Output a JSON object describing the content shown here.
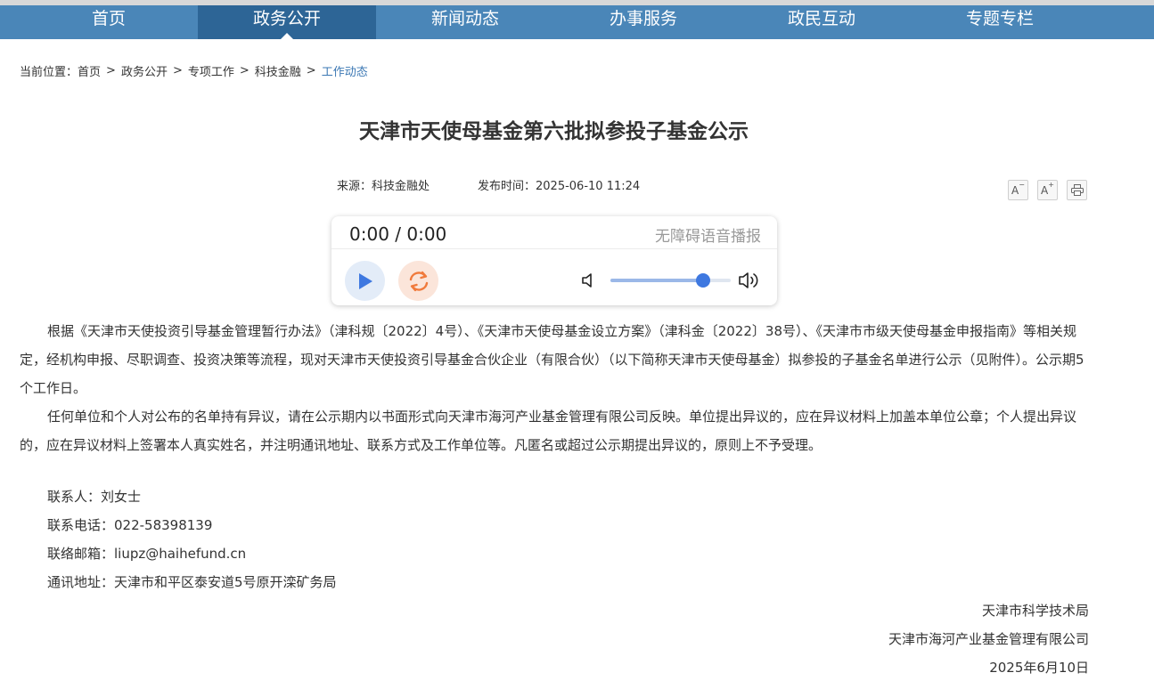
{
  "nav": {
    "items": [
      {
        "label": "首页"
      },
      {
        "label": "政务公开"
      },
      {
        "label": "新闻动态"
      },
      {
        "label": "办事服务"
      },
      {
        "label": "政民互动"
      },
      {
        "label": "专题专栏"
      }
    ],
    "active_index": 1
  },
  "breadcrumb": {
    "prefix": "当前位置：",
    "items": [
      "首页",
      "政务公开",
      "专项工作",
      "科技金融"
    ],
    "current": "工作动态",
    "separator": ">"
  },
  "article": {
    "title": "天津市天使母基金第六批拟参投子基金公示",
    "source": "来源：科技金融处",
    "publish_time": "发布时间：2025-06-10 11:24",
    "paragraphs": [
      "根据《天津市天使投资引导基金管理暂行办法》（津科规〔2022〕4号）、《天津市天使母基金设立方案》（津科金〔2022〕38号）、《天津市市级天使母基金申报指南》等相关规定，经机构申报、尽职调查、投资决策等流程，现对天津市天使投资引导基金合伙企业（有限合伙）（以下简称天津市天使母基金）拟参投的子基金名单进行公示（见附件）。公示期5个工作日。",
      "任何单位和个人对公布的名单持有异议，请在公示期内以书面形式向天津市海河产业基金管理有限公司反映。单位提出异议的，应在异议材料上加盖本单位公章；个人提出异议的，应在异议材料上签署本人真实姓名，并注明通讯地址、联系方式及工作单位等。凡匿名或超过公示期提出异议的，原则上不予受理。"
    ],
    "contacts": [
      "联系人：刘女士",
      "联系电话：022-58398139",
      "联络邮箱：liupz@haihefund.cn",
      "通讯地址：天津市和平区泰安道5号原开滦矿务局"
    ],
    "signature": [
      "天津市科学技术局",
      "天津市海河产业基金管理有限公司",
      "2025年6月10日"
    ]
  },
  "tools": {
    "decrease_font_icon": "font-decrease-icon",
    "increase_font_icon": "font-increase-icon",
    "print_icon": "print-icon"
  },
  "player": {
    "time": "0:00 / 0:00",
    "label": "无障碍语音播报",
    "volume": 0.77,
    "colors": {
      "play": "#3e78e0",
      "loop": "#f07a3c"
    }
  }
}
